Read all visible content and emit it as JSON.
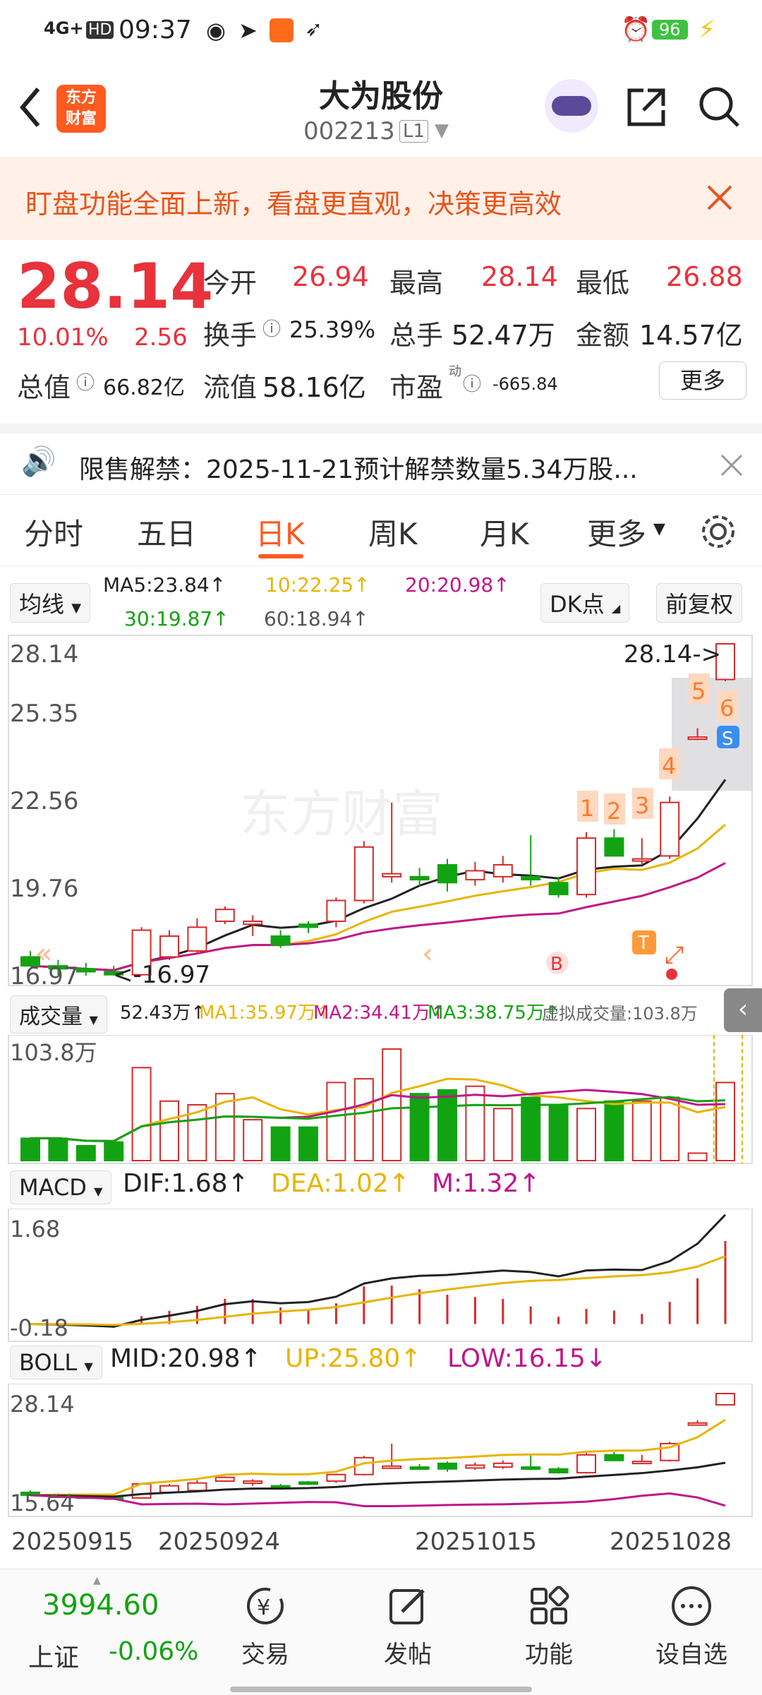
{
  "status_bar": {
    "signal": "4G+",
    "hd": "HD",
    "time": "09:37",
    "battery": "96"
  },
  "header": {
    "logo_text": "东方\n财富",
    "title": "大为股份",
    "code": "002213",
    "level": "L1"
  },
  "notice": {
    "text": "盯盘功能全面上新，看盘更直观，决策更高效"
  },
  "quote": {
    "price": "28.14",
    "change_pct": "10.01%",
    "change": "2.56",
    "open_label": "今开",
    "open": "26.94",
    "high_label": "最高",
    "high": "28.14",
    "low_label": "最低",
    "low": "26.88",
    "turnover_label": "换手",
    "turnover": "25.39%",
    "volume_label": "总手",
    "volume": "52.47万",
    "amount_label": "金额",
    "amount": "14.57亿",
    "mktcap_label": "总值",
    "mktcap": "66.82亿",
    "float_label": "流值",
    "float_cap": "58.16亿",
    "pe_label": "市盈",
    "pe_sup": "动",
    "pe": "-665.84",
    "more_button": "更多"
  },
  "unlock": {
    "text": "限售解禁：2025-11-21预计解禁数量5.34万股..."
  },
  "tabs": [
    "分时",
    "五日",
    "日K",
    "周K",
    "月K",
    "更多"
  ],
  "active_tab": "日K",
  "ma_bar": {
    "type": "均线",
    "ma5": "MA5:23.84↑",
    "ma10": "10:22.25↑",
    "ma20": "20:20.98↑",
    "ma30": "30:19.87↑",
    "ma60": "60:18.94↑",
    "dk_button": "DK点",
    "adjust_button": "前复权"
  },
  "kline": {
    "y_labels": [
      "28.14",
      "25.35",
      "22.56",
      "19.76",
      "16.97"
    ],
    "max_label": "28.14->",
    "min_label": "<-16.97",
    "watermark": "东方财富",
    "markers": [
      "1",
      "2",
      "3",
      "4",
      "5",
      "6"
    ],
    "s_marker": "S",
    "b_marker": "B",
    "t_marker": "T"
  },
  "volume_bar": {
    "type": "成交量",
    "vol": "52.43万↑",
    "ma1": "MA1:35.97万↑",
    "ma2": "MA2:34.41万↑",
    "ma3": "MA3:38.75万↑",
    "virtual": "虚拟成交量:103.8万",
    "y_top": "103.8万"
  },
  "macd_bar": {
    "type": "MACD",
    "dif": "DIF:1.68↑",
    "dea": "DEA:1.02↑",
    "m": "M:1.32↑",
    "y_top": "1.68",
    "y_bottom": "-0.18"
  },
  "boll_bar": {
    "type": "BOLL",
    "mid": "MID:20.98↑",
    "up": "UP:25.80↑",
    "low": "LOW:16.15↓",
    "y_top": "28.14",
    "y_bottom": "15.64"
  },
  "dates": [
    "20250915",
    "20250924",
    "20251015",
    "20251028"
  ],
  "bottom_nav": {
    "index_value": "3994.60",
    "index_name": "上证",
    "index_change": "-0.06%",
    "items": [
      "交易",
      "发帖",
      "功能",
      "设自选"
    ]
  },
  "chart_data": {
    "type": "candlestick",
    "candles": [
      {
        "o": 17.6,
        "h": 17.8,
        "l": 17.3,
        "c": 17.3
      },
      {
        "o": 17.3,
        "h": 17.5,
        "l": 17.0,
        "c": 17.2
      },
      {
        "o": 17.2,
        "h": 17.4,
        "l": 16.97,
        "c": 17.1
      },
      {
        "o": 17.1,
        "h": 17.3,
        "l": 16.97,
        "c": 17.0
      },
      {
        "o": 17.0,
        "h": 18.6,
        "l": 16.97,
        "c": 18.5
      },
      {
        "o": 17.6,
        "h": 18.5,
        "l": 17.5,
        "c": 18.3
      },
      {
        "o": 17.8,
        "h": 18.9,
        "l": 17.7,
        "c": 18.6
      },
      {
        "o": 18.8,
        "h": 19.3,
        "l": 18.7,
        "c": 19.2
      },
      {
        "o": 18.7,
        "h": 19.0,
        "l": 18.3,
        "c": 18.8
      },
      {
        "o": 18.3,
        "h": 18.5,
        "l": 17.9,
        "c": 18.0
      },
      {
        "o": 18.7,
        "h": 18.8,
        "l": 18.4,
        "c": 18.6
      },
      {
        "o": 18.8,
        "h": 19.6,
        "l": 18.6,
        "c": 19.5
      },
      {
        "o": 19.5,
        "h": 21.5,
        "l": 19.4,
        "c": 21.3
      },
      {
        "o": 20.3,
        "h": 22.8,
        "l": 20.1,
        "c": 20.4
      },
      {
        "o": 20.3,
        "h": 20.6,
        "l": 20.0,
        "c": 20.2
      },
      {
        "o": 20.7,
        "h": 20.9,
        "l": 19.8,
        "c": 20.1
      },
      {
        "o": 20.2,
        "h": 20.8,
        "l": 20.0,
        "c": 20.5
      },
      {
        "o": 20.3,
        "h": 21.0,
        "l": 20.1,
        "c": 20.7
      },
      {
        "o": 20.3,
        "h": 21.7,
        "l": 20.0,
        "c": 20.2
      },
      {
        "o": 20.1,
        "h": 20.3,
        "l": 19.6,
        "c": 19.7
      },
      {
        "o": 19.7,
        "h": 21.8,
        "l": 19.6,
        "c": 21.6
      },
      {
        "o": 21.6,
        "h": 21.9,
        "l": 21.0,
        "c": 21.0
      },
      {
        "o": 20.9,
        "h": 21.6,
        "l": 20.7,
        "c": 20.9
      },
      {
        "o": 21.0,
        "h": 23.0,
        "l": 20.9,
        "c": 22.8
      },
      {
        "o": 25.0,
        "h": 25.3,
        "l": 24.9,
        "c": 25.0
      },
      {
        "o": 26.94,
        "h": 28.14,
        "l": 26.88,
        "c": 28.14
      }
    ],
    "volumes": [
      6,
      6,
      4,
      5,
      25,
      16,
      15,
      18,
      11,
      9,
      9,
      21,
      22,
      30,
      18,
      19,
      20,
      14,
      17,
      15,
      14,
      16,
      16,
      17,
      2,
      21
    ]
  }
}
